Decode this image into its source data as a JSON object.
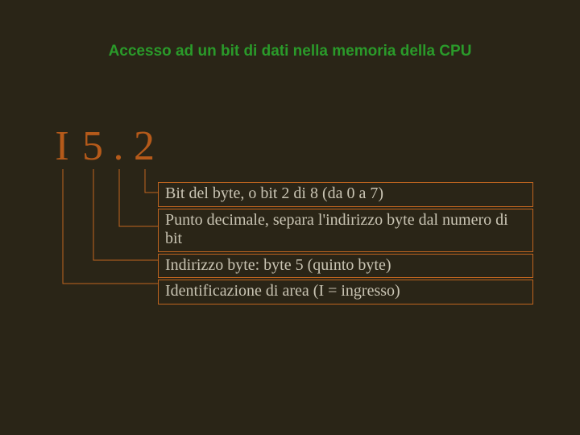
{
  "title": "Accesso ad un bit di dati nella memoria della CPU",
  "address": {
    "c1": "I",
    "c2": "5",
    "c3": ".",
    "c4": "2"
  },
  "rows": {
    "r1": "Bit del byte, o bit 2 di 8 (da 0 a 7)",
    "r2": "Punto decimale, separa l'indirizzo byte dal numero di bit",
    "r3": "Indirizzo byte: byte 5 (quinto byte)",
    "r4": "Identificazione di area (I = ingresso)"
  },
  "colors": {
    "accent": "#c0651f",
    "title": "#2a9a2a",
    "text": "#c9c4b3",
    "bg": "#2a2517"
  }
}
